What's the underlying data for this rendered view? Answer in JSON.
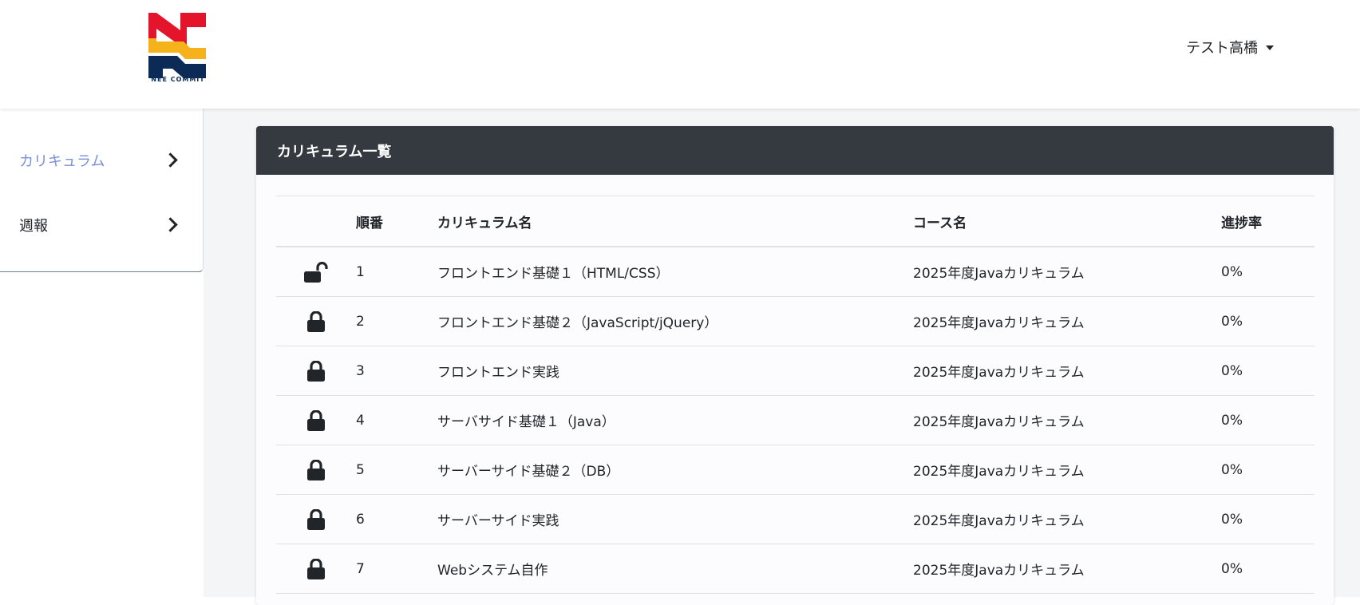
{
  "header": {
    "logo_text": "NEE COMMIT",
    "user_name": "テスト高橋"
  },
  "sidebar": {
    "items": [
      {
        "label": "カリキュラム"
      },
      {
        "label": "週報"
      }
    ]
  },
  "card": {
    "title": "カリキュラム一覧"
  },
  "table": {
    "headers": [
      "順番",
      "カリキュラム名",
      "コース名",
      "進捗率"
    ],
    "rows": [
      {
        "lock": "unlock-icon",
        "no": "1",
        "name": "フロントエンド基礎１（HTML/CSS）",
        "course": "2025年度Javaカリキュラム",
        "rate": "0%"
      },
      {
        "lock": "lock-icon",
        "no": "2",
        "name": "フロントエンド基礎２（JavaScript/jQuery）",
        "course": "2025年度Javaカリキュラム",
        "rate": "0%"
      },
      {
        "lock": "lock-icon",
        "no": "3",
        "name": "フロントエンド実践",
        "course": "2025年度Javaカリキュラム",
        "rate": "0%"
      },
      {
        "lock": "lock-icon",
        "no": "4",
        "name": "サーバサイド基礎１（Java）",
        "course": "2025年度Javaカリキュラム",
        "rate": "0%"
      },
      {
        "lock": "lock-icon",
        "no": "5",
        "name": "サーバーサイド基礎２（DB）",
        "course": "2025年度Javaカリキュラム",
        "rate": "0%"
      },
      {
        "lock": "lock-icon",
        "no": "6",
        "name": "サーバーサイド実践",
        "course": "2025年度Javaカリキュラム",
        "rate": "0%"
      },
      {
        "lock": "lock-icon",
        "no": "7",
        "name": "Webシステム自作",
        "course": "2025年度Javaカリキュラム",
        "rate": "0%"
      }
    ]
  },
  "colors": {
    "header_bar": "#343a40",
    "active_nav": "#7b90d6",
    "main_bg": "#f4f5f7",
    "logo_red": "#e4142b",
    "logo_yellow": "#f6b21a",
    "logo_navy": "#0b2a55"
  }
}
